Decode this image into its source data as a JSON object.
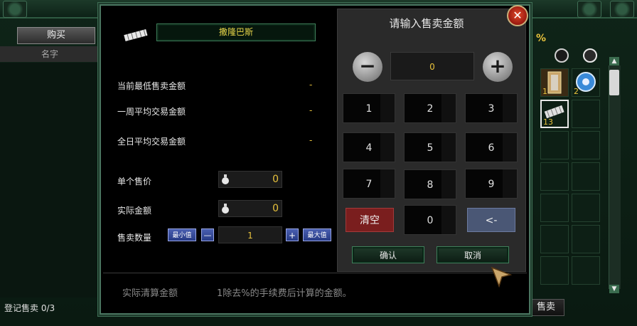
{
  "background": {
    "buy_tab": "购买",
    "name_column": "名字",
    "registered_sales": "登记售卖 0/3",
    "sell_tab": "售卖",
    "inventory_percent": "%",
    "inventory_slots": [
      {
        "count": "1"
      },
      {
        "count": "2"
      },
      {
        "count": "13"
      }
    ]
  },
  "dialog": {
    "item_name": "撒隆巴斯",
    "rows": [
      {
        "label": "当前最低售卖金额",
        "value": "-"
      },
      {
        "label": "一周平均交易金额",
        "value": "-"
      },
      {
        "label": "全日平均交易金额",
        "value": "-"
      }
    ],
    "unit_price_label": "单个售价",
    "unit_price_value": "0",
    "actual_amount_label": "实际金额",
    "actual_amount_value": "0",
    "quantity_label": "售卖数量",
    "min_label": "最小值",
    "minus_small": "—",
    "quantity_value": "1",
    "plus_small": "+",
    "max_label": "最大值",
    "footer_title": "实际清算金额",
    "footer_desc": "1除去%的手续费后计算的金额。"
  },
  "keypad": {
    "title": "请输入售卖金额",
    "minus": "−",
    "plus": "+",
    "amount": "0",
    "keys": [
      "1",
      "2",
      "3",
      "4",
      "5",
      "6",
      "7",
      "8",
      "9"
    ],
    "clear": "清空",
    "zero": "0",
    "backspace": "<-",
    "confirm": "确认",
    "cancel": "取消",
    "close": "✕"
  }
}
